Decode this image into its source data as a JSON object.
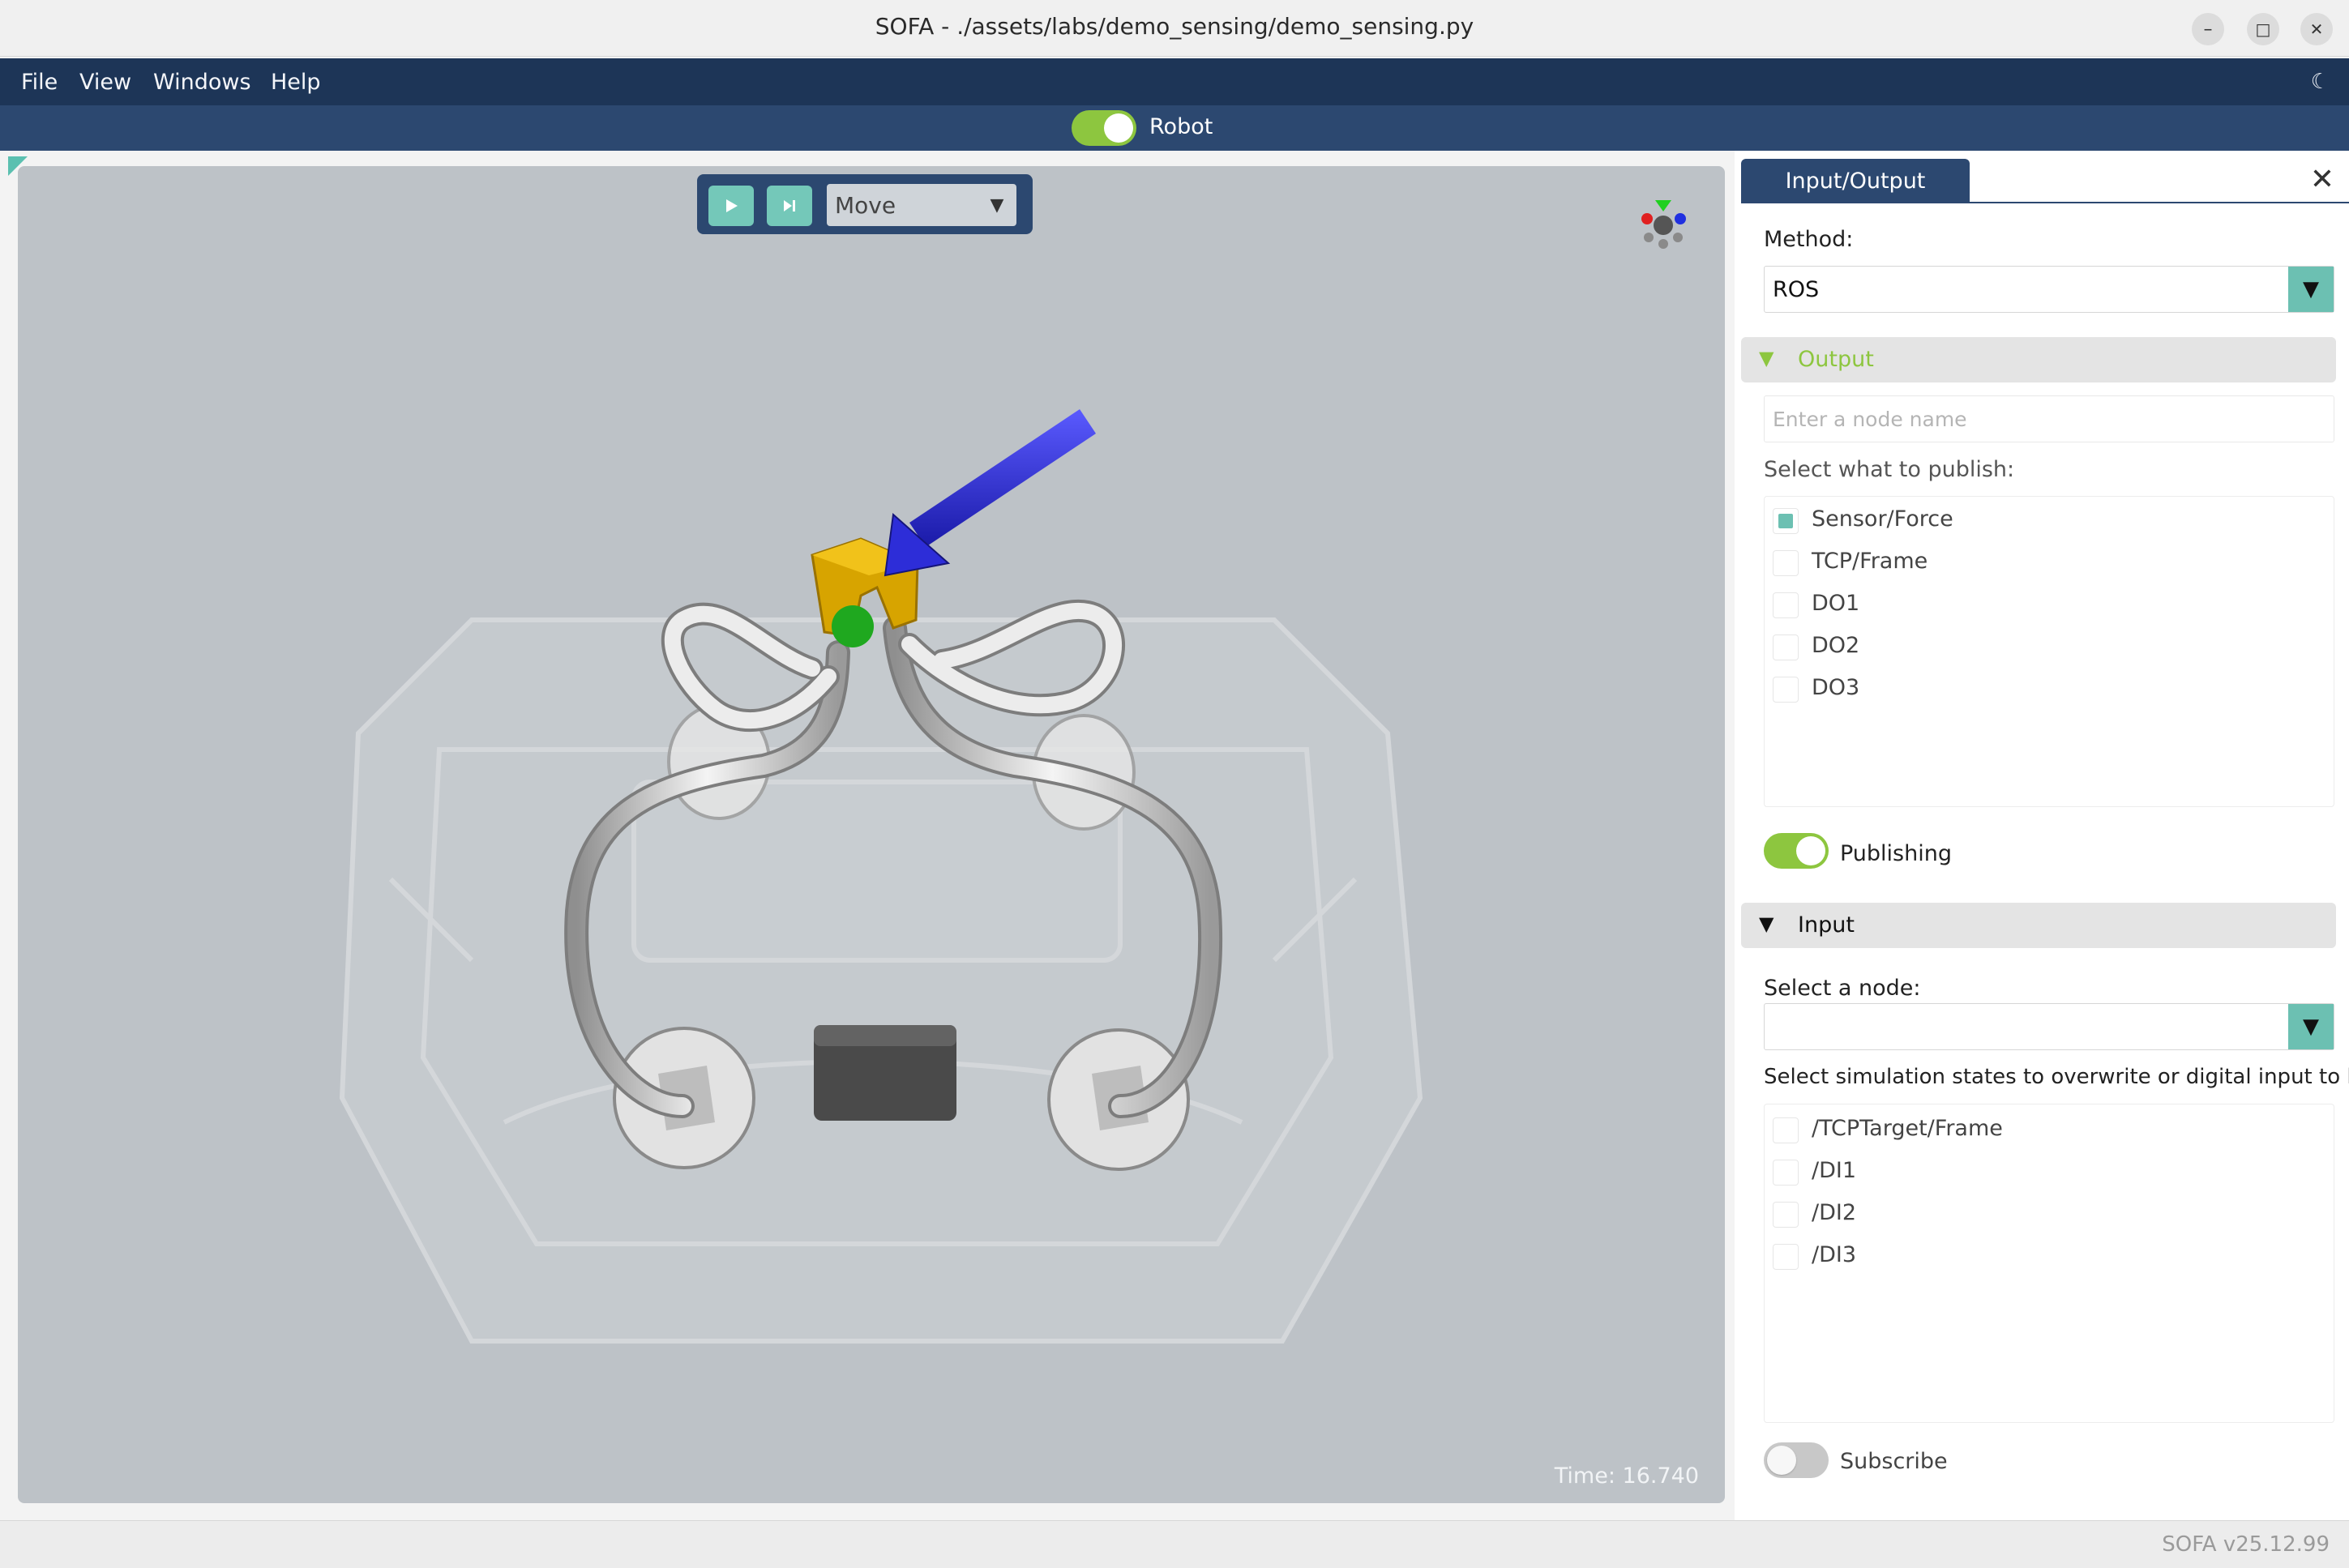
{
  "window": {
    "title": "SOFA - ./assets/labs/demo_sensing/demo_sensing.py",
    "minimize_glyph": "–",
    "maximize_glyph": "□",
    "close_glyph": "✕"
  },
  "menu": {
    "items": [
      "File",
      "View",
      "Windows",
      "Help"
    ],
    "theme_glyph": "☾"
  },
  "robot_bar": {
    "label": "Robot",
    "enabled": true
  },
  "viewport": {
    "toolbar": {
      "mode": "Move",
      "mode_arrow": "▼"
    },
    "time_text": "Time: 16.740",
    "background_color": "#bdc2c7"
  },
  "panel": {
    "tab_label": "Input/Output",
    "close_glyph": "✕",
    "method_label": "Method:",
    "method_value": "ROS",
    "output": {
      "title": "Output",
      "toggle_glyph": "▼",
      "node_placeholder": "Enter a node name",
      "publish_label": "Select what to publish:",
      "items": [
        {
          "label": "Sensor/Force",
          "checked": true
        },
        {
          "label": "TCP/Frame",
          "checked": false
        },
        {
          "label": "DO1",
          "checked": false
        },
        {
          "label": "DO2",
          "checked": false
        },
        {
          "label": "DO3",
          "checked": false
        }
      ],
      "publishing_label": "Publishing",
      "publishing_on": true
    },
    "input": {
      "title": "Input",
      "toggle_glyph": "▼",
      "node_label": "Select a node:",
      "node_value": "",
      "states_label": "Select simulation states to overwrite or digital input to list",
      "items": [
        {
          "label": "/TCPTarget/Frame",
          "checked": false
        },
        {
          "label": "/DI1",
          "checked": false
        },
        {
          "label": "/DI2",
          "checked": false
        },
        {
          "label": "/DI3",
          "checked": false
        }
      ],
      "subscribe_label": "Subscribe",
      "subscribe_on": false
    }
  },
  "status": {
    "version": "SOFA v25.12.99"
  },
  "colors": {
    "menu_bg": "#1d3557",
    "bar_bg": "#2c4870",
    "accent_teal": "#6cc0b2",
    "toggle_green": "#8dc63f",
    "output_header_text": "#8dc63f"
  }
}
